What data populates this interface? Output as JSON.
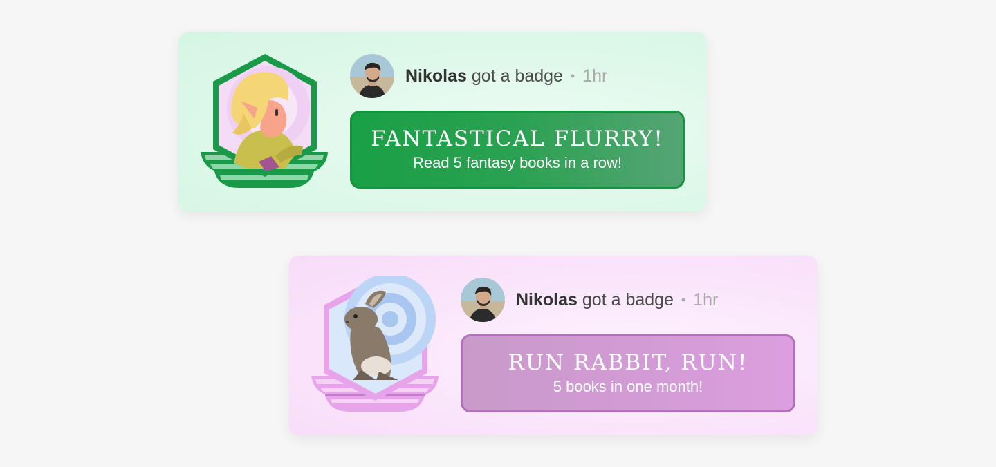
{
  "cards": [
    {
      "user": "Nikolas",
      "action": "got a badge",
      "separator": "•",
      "time": "1hr",
      "badge_title": "FANTASTICAL FLURRY!",
      "badge_description": "Read 5 fantasy books in a row!",
      "badge_icon": "elf-icon",
      "colors": {
        "accent": "#19a045",
        "border": "#14943f",
        "background": "#dcf8e9"
      }
    },
    {
      "user": "Nikolas",
      "action": "got a badge",
      "separator": "•",
      "time": "1hr",
      "badge_title": "RUN RABBIT, RUN!",
      "badge_description": "5 books in one month!",
      "badge_icon": "rabbit-icon",
      "colors": {
        "accent": "#d29bd6",
        "border": "#b46fbe",
        "background": "#f9e3fa"
      }
    }
  ]
}
